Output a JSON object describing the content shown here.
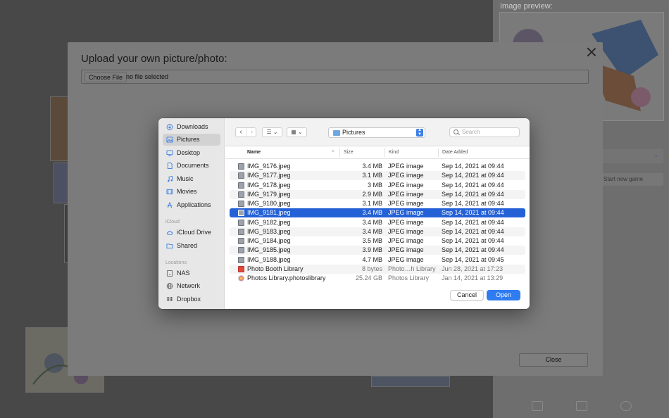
{
  "background": {
    "preview_label": "Image preview:",
    "start_button": "Start new game"
  },
  "modal": {
    "title": "Upload your own picture/photo:",
    "choose_file_label": "Choose File",
    "no_file_text": "no file selected",
    "close_label": "Close"
  },
  "dialog": {
    "sidebar": {
      "favorites": [
        {
          "label": "Downloads",
          "icon": "download-icon"
        },
        {
          "label": "Pictures",
          "icon": "pictures-icon",
          "selected": true
        },
        {
          "label": "Desktop",
          "icon": "desktop-icon"
        },
        {
          "label": "Documents",
          "icon": "document-icon"
        },
        {
          "label": "Music",
          "icon": "music-icon"
        },
        {
          "label": "Movies",
          "icon": "movies-icon"
        },
        {
          "label": "Applications",
          "icon": "applications-icon"
        }
      ],
      "icloud_heading": "iCloud",
      "icloud": [
        {
          "label": "iCloud Drive",
          "icon": "cloud-icon"
        },
        {
          "label": "Shared",
          "icon": "shared-folder-icon"
        }
      ],
      "locations_heading": "Locations",
      "locations": [
        {
          "label": "NAS",
          "icon": "disk-icon"
        },
        {
          "label": "Network",
          "icon": "globe-icon"
        },
        {
          "label": "Dropbox",
          "icon": "dropbox-icon"
        }
      ]
    },
    "toolbar": {
      "back_glyph": "‹",
      "forward_glyph": "›",
      "list_view_glyph": "☰ ⌄",
      "grid_view_glyph": "▦ ⌄",
      "path_label": "Pictures",
      "search_placeholder": "Search"
    },
    "columns": {
      "name": "Name",
      "size": "Size",
      "kind": "Kind",
      "date": "Date Added"
    },
    "files": [
      {
        "name": "IMG_9176.jpeg",
        "size": "3.4 MB",
        "kind": "JPEG image",
        "date": "Sep 14, 2021 at 09:44"
      },
      {
        "name": "IMG_9177.jpeg",
        "size": "3.1 MB",
        "kind": "JPEG image",
        "date": "Sep 14, 2021 at 09:44"
      },
      {
        "name": "IMG_9178.jpeg",
        "size": "3 MB",
        "kind": "JPEG image",
        "date": "Sep 14, 2021 at 09:44"
      },
      {
        "name": "IMG_9179.jpeg",
        "size": "2.9 MB",
        "kind": "JPEG image",
        "date": "Sep 14, 2021 at 09:44"
      },
      {
        "name": "IMG_9180.jpeg",
        "size": "3.1 MB",
        "kind": "JPEG image",
        "date": "Sep 14, 2021 at 09:44"
      },
      {
        "name": "IMG_9181.jpeg",
        "size": "3.4 MB",
        "kind": "JPEG image",
        "date": "Sep 14, 2021 at 09:44",
        "selected": true
      },
      {
        "name": "IMG_9182.jpeg",
        "size": "3.4 MB",
        "kind": "JPEG image",
        "date": "Sep 14, 2021 at 09:44"
      },
      {
        "name": "IMG_9183.jpeg",
        "size": "3.4 MB",
        "kind": "JPEG image",
        "date": "Sep 14, 2021 at 09:44"
      },
      {
        "name": "IMG_9184.jpeg",
        "size": "3.5 MB",
        "kind": "JPEG image",
        "date": "Sep 14, 2021 at 09:44"
      },
      {
        "name": "IMG_9185.jpeg",
        "size": "3.9 MB",
        "kind": "JPEG image",
        "date": "Sep 14, 2021 at 09:44"
      },
      {
        "name": "IMG_9188.jpeg",
        "size": "4.7 MB",
        "kind": "JPEG image",
        "date": "Sep 14, 2021 at 09:45"
      },
      {
        "name": "Photo Booth Library",
        "size": "8 bytes",
        "kind": "Photo…h Library",
        "date": "Jun 28, 2021 at 17:23",
        "icon": "photo-booth-icon",
        "dim": true
      },
      {
        "name": "Photos Library.photoslibrary",
        "size": "25.24 GB",
        "kind": "Photos Library",
        "date": "Jan 14, 2021 at 13:29",
        "icon": "photos-icon",
        "dim": true
      }
    ],
    "cancel_label": "Cancel",
    "open_label": "Open"
  }
}
